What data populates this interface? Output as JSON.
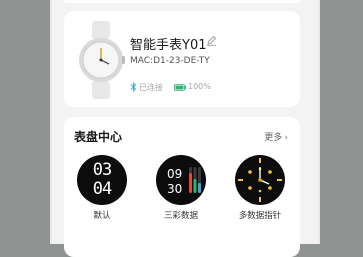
{
  "device": {
    "name": "智能手表Y01",
    "mac": "MAC:D1-23-DE-TY",
    "connection_status": "已连接",
    "battery": "100%",
    "battery_level": 1.0,
    "icons": [
      "watch-image",
      "edit-icon",
      "bluetooth-icon",
      "battery-icon"
    ]
  },
  "watch_faces": {
    "title": "表盘中心",
    "more_label": "更多",
    "items": [
      {
        "label": "默认",
        "digits_top": "03",
        "digits_bottom": "04"
      },
      {
        "label": "三彩数据",
        "hour": "09",
        "minute": "30"
      },
      {
        "label": "多数据指针"
      }
    ]
  },
  "colors": {
    "background": "#f3f3f3",
    "card": "#ffffff",
    "accent_green": "#2bb673",
    "bluetooth": "#3fa7d6"
  }
}
